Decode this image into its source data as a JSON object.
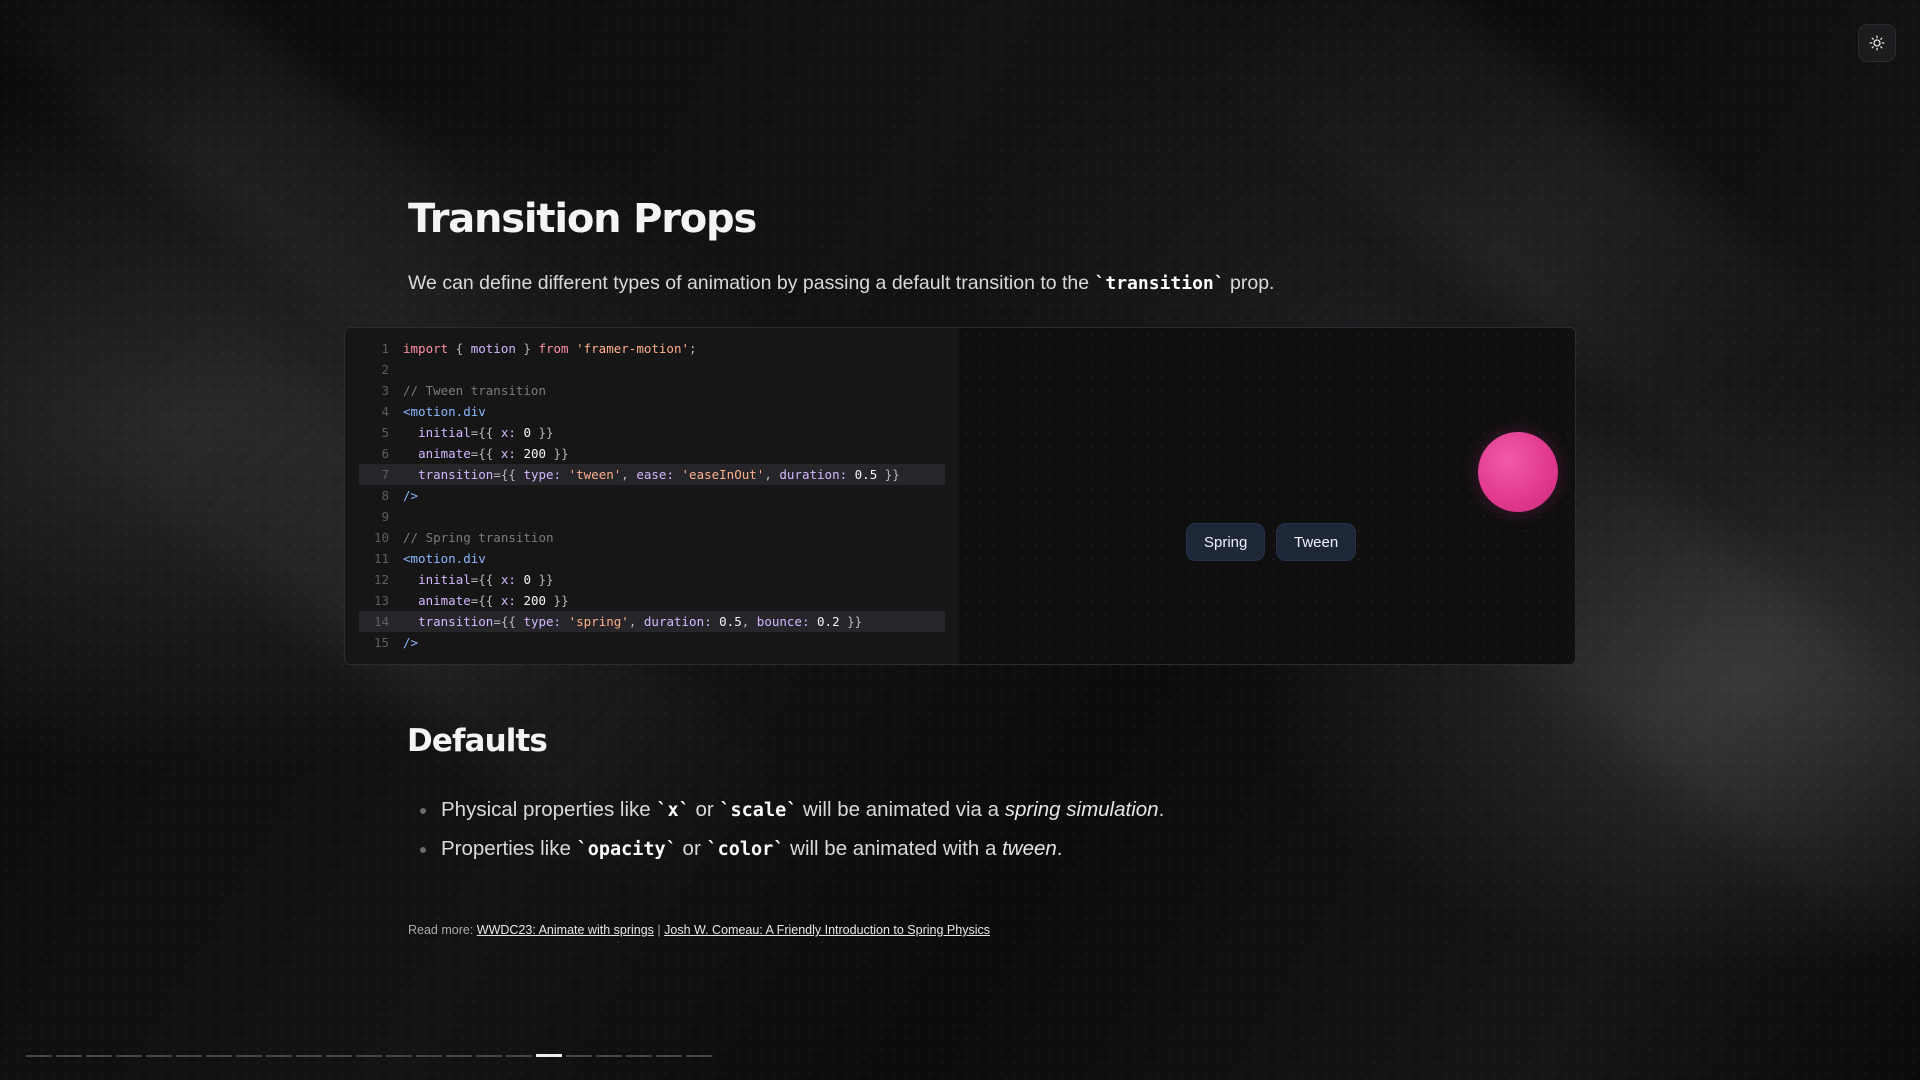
{
  "header": {
    "theme_toggle_icon": "sun-icon"
  },
  "slide": {
    "title": "Transition Props",
    "lead_prefix": "We can define different types of animation by passing a default transition to the ",
    "lead_code": "`transition`",
    "lead_suffix": " prop."
  },
  "code_block": {
    "lines": [
      {
        "n": "1",
        "html_key": "l1"
      },
      {
        "n": "2"
      },
      {
        "n": "3"
      },
      {
        "n": "4"
      },
      {
        "n": "5"
      },
      {
        "n": "6"
      },
      {
        "n": "7"
      },
      {
        "n": "8"
      },
      {
        "n": "9"
      },
      {
        "n": "10"
      },
      {
        "n": "11"
      },
      {
        "n": "12"
      },
      {
        "n": "13"
      },
      {
        "n": "14"
      },
      {
        "n": "15"
      }
    ],
    "text": {
      "import_kw": "import",
      "import_brace_open": " { ",
      "import_name": "motion",
      "import_brace_close": " } ",
      "from_kw": "from",
      "module": "'framer-motion'",
      "semicolon": ";",
      "tween_comment": "// Tween transition",
      "spring_comment": "// Spring transition",
      "motion_tag": "<motion.div",
      "initial_attr": "initial",
      "animate_attr": "animate",
      "transition_attr": "transition",
      "x_key": "x:",
      "type_key": "type:",
      "ease_key": "ease:",
      "duration_key": "duration:",
      "bounce_key": "bounce:",
      "zero": "0",
      "two_hundred": "200",
      "tween_str": "'tween'",
      "ease_str": "'easeInOut'",
      "spring_str": "'spring'",
      "half": "0.5",
      "bounce_val": "0.2",
      "close_tag": "/>",
      "open_obj": "={{ ",
      "close_obj": " }}",
      "comma": ", "
    }
  },
  "preview": {
    "buttons": {
      "spring": "Spring",
      "tween": "Tween"
    },
    "ball_color": "#e0388d"
  },
  "defaults": {
    "heading": "Defaults",
    "bullet1": {
      "prefix": "Physical properties like ",
      "code1": "`x`",
      "mid": " or ",
      "code2": "`scale`",
      "after": " will be animated via a ",
      "emph": "spring simulation",
      "end": "."
    },
    "bullet2": {
      "prefix": "Properties like ",
      "code1": "`opacity`",
      "mid": " or ",
      "code2": "`color`",
      "after": " will be animated with a ",
      "emph": "tween",
      "end": "."
    }
  },
  "read_more": {
    "label": "Read more: ",
    "link1": "WWDC23: Animate with springs",
    "separator": " | ",
    "link2": "Josh W. Comeau: A Friendly Introduction to Spring Physics"
  },
  "progress": {
    "total_slides": 23,
    "current_slide": 18
  }
}
